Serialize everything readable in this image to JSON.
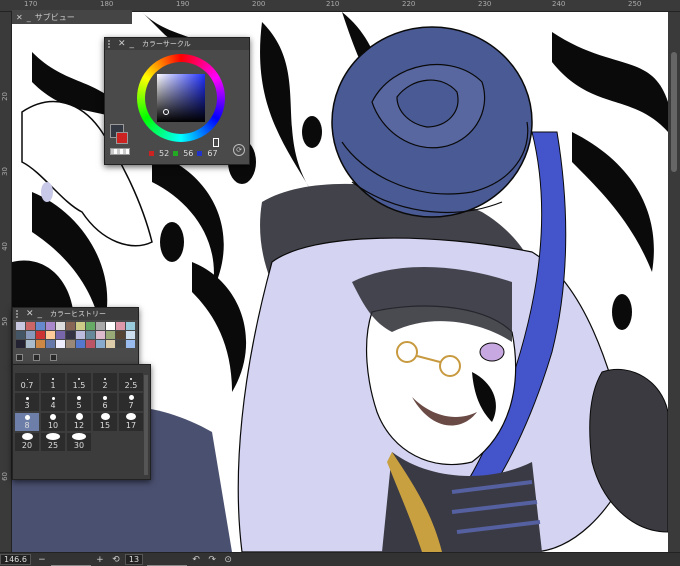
{
  "ruler": {
    "top_labels": [
      "170",
      "180",
      "190",
      "200",
      "210",
      "220",
      "230",
      "240",
      "250"
    ],
    "left_labels": [
      "20",
      "30",
      "40",
      "50",
      "60"
    ]
  },
  "subview": {
    "title": "サブビュー"
  },
  "color_circle": {
    "title": "カラーサークル",
    "r": "52",
    "g": "56",
    "b": "67",
    "main_color": "#343843",
    "sub_color": "#cc2222"
  },
  "color_history": {
    "title": "カラーヒストリー",
    "swatches": [
      "#c8c8e0",
      "#cc6666",
      "#6688cc",
      "#aa88cc",
      "#dddddd",
      "#886655",
      "#cccc88",
      "#66aa66",
      "#aaaaaa",
      "#ffffff",
      "#dd99aa",
      "#99ccdd",
      "#445566",
      "#8899bb",
      "#cc3333",
      "#ffcc99",
      "#7766aa",
      "#333344",
      "#bbbbdd",
      "#668899",
      "#ddbbcc",
      "#99aa77",
      "#554433",
      "#ccddee",
      "#222233",
      "#aabbcc",
      "#cc8844",
      "#6677aa",
      "#eeeeff",
      "#998877",
      "#5577cc",
      "#bb5566",
      "#88aacc",
      "#ddccaa",
      "#444444",
      "#99bbee"
    ]
  },
  "brush_sizes": {
    "rows": [
      [
        "0.7",
        "1",
        "1.5",
        "2",
        "2.5",
        "3"
      ],
      [
        "4",
        "5",
        "6",
        "7",
        "8",
        "10"
      ],
      [
        "12",
        "15",
        "17",
        "20",
        "25",
        "30"
      ]
    ],
    "selected": "8"
  },
  "status": {
    "zoom": "146.6",
    "rotation": "13"
  },
  "colors": {
    "ink": "#0a0a0a",
    "rose": "#4a5a94",
    "hair": "#d4d4f2",
    "hair_accent": "#4455cc",
    "skin": "#ffffff",
    "dark_cloth": "#3a3a44"
  }
}
